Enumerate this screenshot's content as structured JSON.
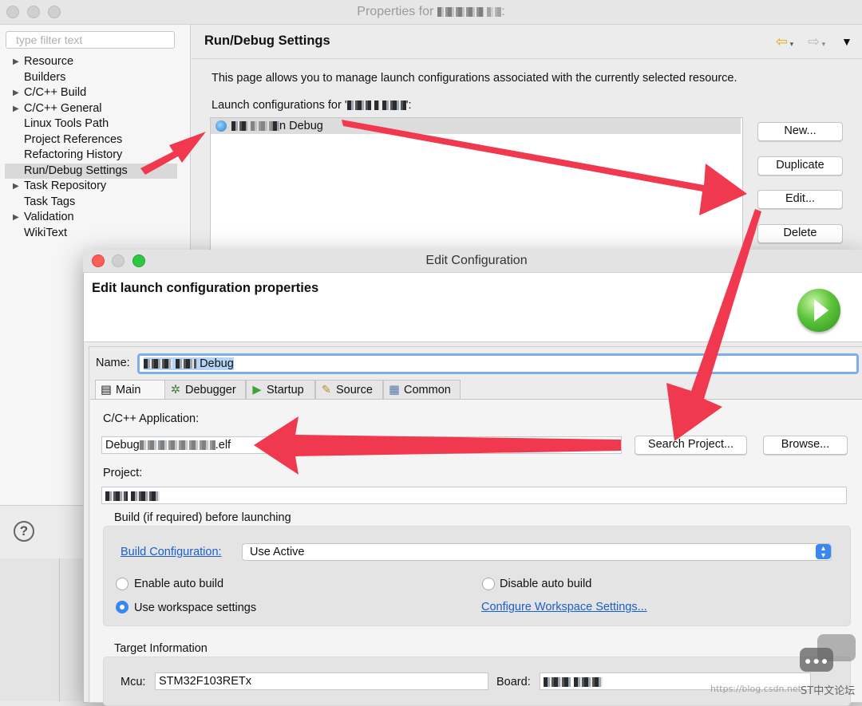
{
  "properties_window": {
    "title_prefix": "Properties for",
    "filter_placeholder": "type filter text",
    "tree": [
      {
        "label": "Resource",
        "expandable": true
      },
      {
        "label": "Builders",
        "expandable": false
      },
      {
        "label": "C/C++ Build",
        "expandable": true
      },
      {
        "label": "C/C++ General",
        "expandable": true
      },
      {
        "label": "Linux Tools Path",
        "expandable": false
      },
      {
        "label": "Project References",
        "expandable": false
      },
      {
        "label": "Refactoring History",
        "expandable": false
      },
      {
        "label": "Run/Debug Settings",
        "expandable": false,
        "selected": true
      },
      {
        "label": "Task Repository",
        "expandable": true
      },
      {
        "label": "Task Tags",
        "expandable": false
      },
      {
        "label": "Validation",
        "expandable": true
      },
      {
        "label": "WikiText",
        "expandable": false
      }
    ],
    "page_title": "Run/Debug Settings",
    "description": "This page allows you to manage launch configurations associated with the currently selected resource.",
    "launch_configs_label_prefix": "Launch configurations for '",
    "launch_configs_label_suffix": "':",
    "launch_config_item_suffix": "n Debug",
    "buttons": {
      "new": "New...",
      "duplicate": "Duplicate",
      "edit": "Edit...",
      "delete": "Delete"
    },
    "help_glyph": "?"
  },
  "edit_dialog": {
    "title": "Edit Configuration",
    "heading": "Edit launch configuration properties",
    "name_label": "Name:",
    "name_value_suffix": "Debug",
    "tabs": [
      {
        "label": "Main",
        "icon": "document-icon",
        "active": true
      },
      {
        "label": "Debugger",
        "icon": "bug-icon"
      },
      {
        "label": "Startup",
        "icon": "play-icon"
      },
      {
        "label": "Source",
        "icon": "source-icon"
      },
      {
        "label": "Common",
        "icon": "table-icon"
      }
    ],
    "app_label": "C/C++ Application:",
    "app_value_prefix": "Debug",
    "app_value_suffix": ".elf",
    "search_project_button": "Search Project...",
    "browse_button": "Browse...",
    "project_label": "Project:",
    "build_group_label": "Build (if required) before launching",
    "build_config_link": "Build Configuration:",
    "build_config_value": "Use Active",
    "radios": {
      "enable_auto_build": "Enable auto build",
      "disable_auto_build": "Disable auto build",
      "use_workspace_settings": "Use workspace settings"
    },
    "selected_radio": "use_workspace_settings",
    "configure_workspace_link": "Configure Workspace Settings...",
    "target_group_label": "Target Information",
    "mcu_label": "Mcu:",
    "mcu_value": "STM32F103RETx",
    "board_label": "Board:"
  },
  "watermark": {
    "url_text": "https://blog.csdn.net",
    "site": "ST中文论坛"
  },
  "colors": {
    "arrow": "#f0384f",
    "accent": "#3b87f0",
    "link": "#1a5fc8"
  }
}
